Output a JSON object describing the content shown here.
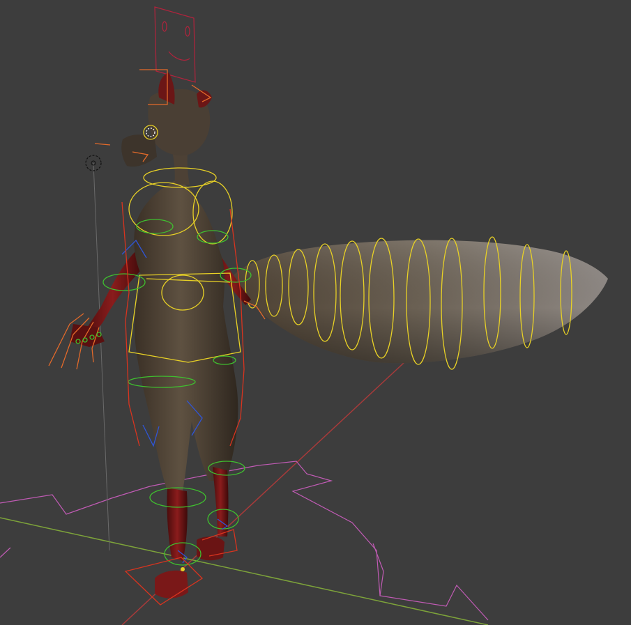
{
  "viewport": {
    "name": "3D Viewport",
    "background": "#3d3d3d"
  },
  "colors": {
    "grid_x_axis": "#a83a3a",
    "grid_y_axis": "#7da33a",
    "lamp_line": "#6a6a6a",
    "bone_ctrl_yellow": "#e8d126",
    "bone_ctrl_green": "#3fbf2f",
    "bone_ctrl_blue": "#2f55d8",
    "bone_ctrl_red": "#d8341f",
    "bone_ctrl_orange": "#e36a2a",
    "floor_ctrl_magenta": "#c15bb5",
    "face_panel": "#b2233d",
    "body_skin": "#54483a",
    "body_red": "#7a1818",
    "tail_fur": "#6d6358"
  },
  "scene_objects": [
    "character-body",
    "fluffy-tail",
    "armature-controls",
    "face-control-panel",
    "floor-root-control",
    "light-object"
  ]
}
